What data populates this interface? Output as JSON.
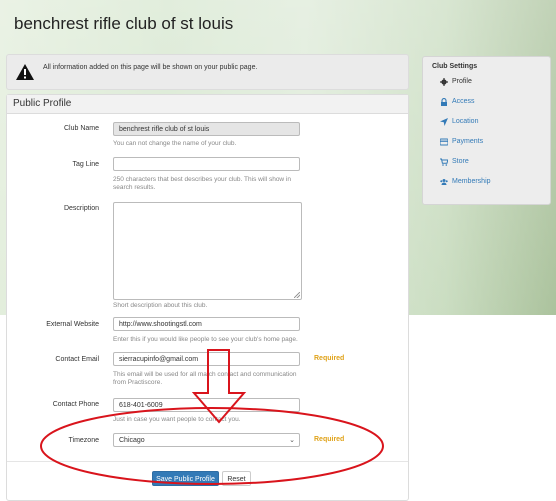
{
  "page": {
    "title": "benchrest rifle club of st louis"
  },
  "alert": {
    "message": "All information added on this page will be shown on your public page."
  },
  "panel": {
    "title": "Public Profile"
  },
  "form": {
    "club_name": {
      "label": "Club Name",
      "value": "benchrest rifle club of st louis",
      "help": "You can not change the name of your club."
    },
    "tag_line": {
      "label": "Tag Line",
      "value": "",
      "help_line1": "250 characters that best describes your club. This will show in",
      "help_line2": "search results."
    },
    "description": {
      "label": "Description",
      "value": "",
      "help": "Short description about this club."
    },
    "website": {
      "label": "External Website",
      "value": "http://www.shootingstl.com",
      "help": "Enter this if you would like people to see your club's home page."
    },
    "contact_email": {
      "label": "Contact Email",
      "value": "sierracupinfo@gmail.com",
      "required": "Required",
      "help_line1": "This email will be used for all match contact and communication",
      "help_line2": "from Practiscore."
    },
    "contact_phone": {
      "label": "Contact Phone",
      "value": "618-401-6009",
      "help": "Just in case you want people to contact you."
    },
    "timezone": {
      "label": "Timezone",
      "value": "Chicago",
      "required": "Required"
    }
  },
  "buttons": {
    "save": "Save Public Profile",
    "reset": "Reset"
  },
  "sidebar": {
    "title": "Club Settings",
    "items": [
      {
        "label": "Profile",
        "icon": "gear-icon",
        "active": true
      },
      {
        "label": "Access",
        "icon": "lock-icon"
      },
      {
        "label": "Location",
        "icon": "location-arrow-icon"
      },
      {
        "label": "Payments",
        "icon": "credit-card-icon"
      },
      {
        "label": "Store",
        "icon": "cart-icon"
      },
      {
        "label": "Membership",
        "icon": "users-icon"
      }
    ]
  },
  "colors": {
    "link": "#337ab7",
    "required": "#e0a31a",
    "primary_button": "#337ab7",
    "annotation": "#d9141c"
  }
}
